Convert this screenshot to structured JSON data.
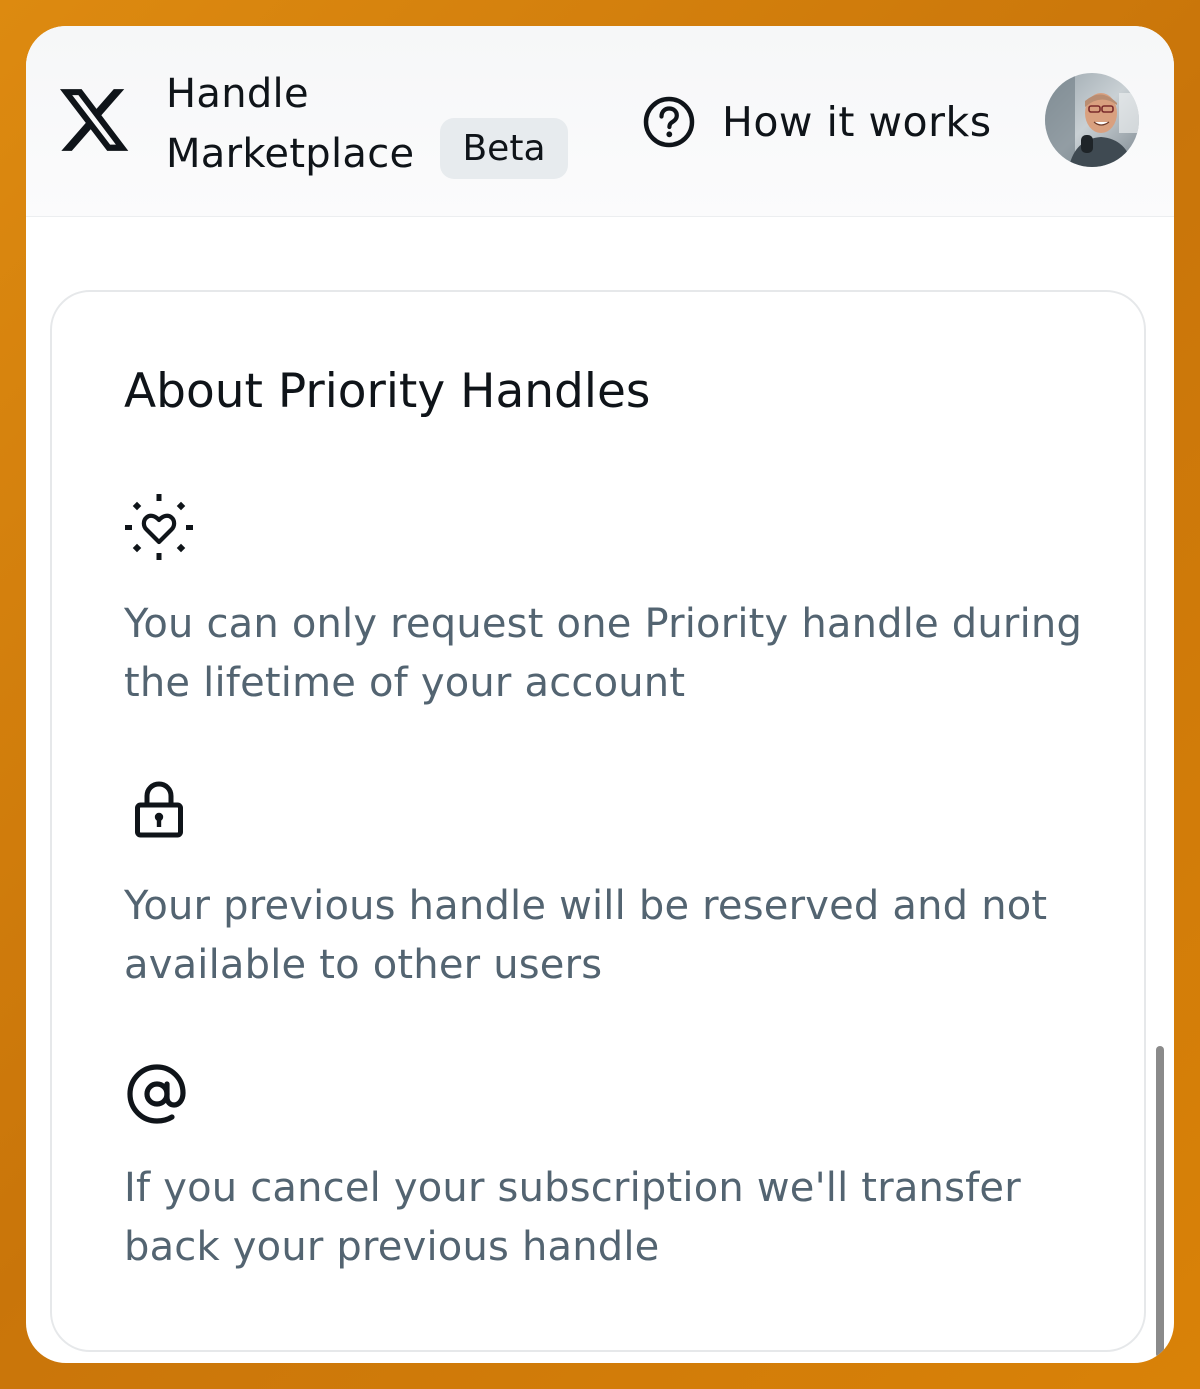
{
  "header": {
    "brand_line1": "Handle",
    "brand_line2": "Marketplace",
    "badge": "Beta",
    "help_label": "How it works"
  },
  "panel": {
    "title": "About Priority Handles",
    "features": [
      {
        "icon": "heart-sparkle-icon",
        "text": "You can only request one Priority handle during the lifetime of your account"
      },
      {
        "icon": "lock-icon",
        "text": "Your previous handle will be reserved and not available to other users"
      },
      {
        "icon": "at-sign-icon",
        "text": "If you cancel your subscription we'll transfer back your previous handle"
      }
    ]
  },
  "colors": {
    "frame": "#d98208",
    "primary_text": "#0f1419",
    "secondary_text": "#536471",
    "badge_bg": "#e7ebee"
  }
}
